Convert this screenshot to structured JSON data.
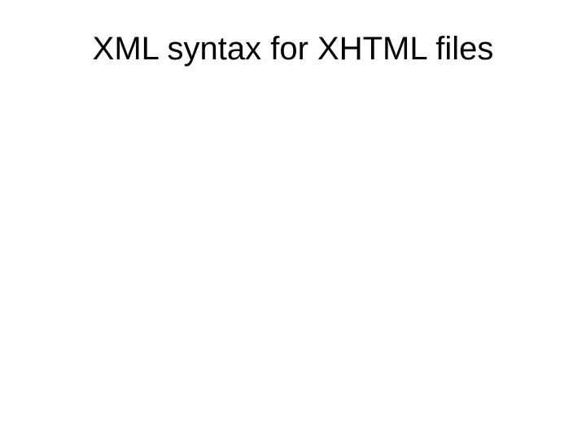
{
  "slide": {
    "title": "XML syntax for XHTML files"
  }
}
